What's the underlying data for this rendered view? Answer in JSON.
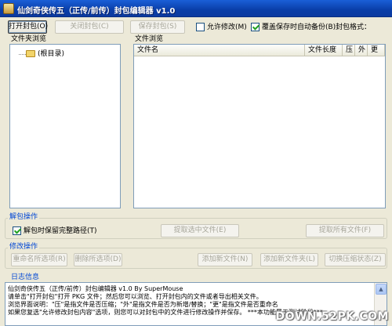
{
  "window": {
    "title": "仙剑奇侠传五（正传/前传）封包编辑器 v1.0"
  },
  "toolbar": {
    "open_label": "打开封包(O)",
    "close_label": "关闭封包(C)",
    "save_label": "保存封包(S)",
    "allow_modify_label": "允许修改(M)",
    "allow_modify_checked": false,
    "auto_backup_label": "覆盖保存时自动备份(B)",
    "auto_backup_checked": true,
    "format_label": "封包格式："
  },
  "folder_browser": {
    "title": "文件夹浏览",
    "root_item": "(根目录)"
  },
  "file_browser": {
    "title": "文件浏览",
    "columns": [
      "文件名",
      "文件长度",
      "压",
      "外",
      "更"
    ]
  },
  "unpack": {
    "title": "解包操作",
    "keep_path_label": "解包时保留完整路径(T)",
    "keep_path_checked": true,
    "extract_selected_label": "提取选中文件(E)",
    "extract_all_label": "提取所有文件(F)"
  },
  "modify": {
    "title": "修改操作",
    "rename_label": "重命名所选项(R)",
    "delete_label": "删除所选项(D)",
    "add_file_label": "添加新文件(N)",
    "add_folder_label": "添加新文件夹(L)",
    "toggle_compress_label": "切换压缩状态(Z)"
  },
  "log": {
    "title": "日志信息",
    "lines": [
      "仙剑奇侠传五（正传/前传）封包编辑器 v1.0 By SuperMouse",
      "请单击\"打开封包\"打开 PKG 文件；然后您可以浏览、打开封包内的文件或者导出相关文件。",
      "浏览界面说明：\"压\"是指文件是否压缩；\"外\"是指文件是否为新增/替换；\"更\"是指文件是否重命名",
      "如果您复选\"允许修改封包内容\"选项，则您可以对封包中的文件进行修改操作并保存。 ***本功能属于测试阶段***"
    ]
  },
  "watermark": "DOWN.52PK.COM"
}
